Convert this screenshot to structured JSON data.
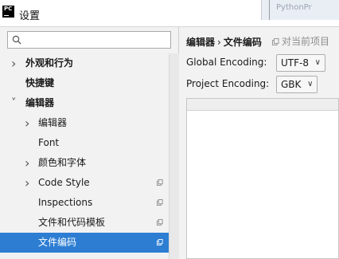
{
  "window": {
    "title": "设置",
    "app_icon_text": "PC",
    "background_text": "PythonPr"
  },
  "search": {
    "value": "",
    "placeholder": ""
  },
  "tree": {
    "items": [
      {
        "label": "外观和行为",
        "level": 0,
        "expander": "right",
        "bold": true
      },
      {
        "label": "快捷键",
        "level": 0,
        "expander": "none",
        "bold": true
      },
      {
        "label": "编辑器",
        "level": 0,
        "expander": "down",
        "bold": true
      },
      {
        "label": "编辑器",
        "level": 1,
        "expander": "right"
      },
      {
        "label": "Font",
        "level": 1,
        "expander": "none"
      },
      {
        "label": "颜色和字体",
        "level": 1,
        "expander": "right"
      },
      {
        "label": "Code Style",
        "level": 1,
        "expander": "right",
        "project_icon": true
      },
      {
        "label": "Inspections",
        "level": 1,
        "expander": "none",
        "project_icon": true
      },
      {
        "label": "文件和代码模板",
        "level": 1,
        "expander": "none",
        "project_icon": true
      },
      {
        "label": "文件编码",
        "level": 1,
        "expander": "none",
        "project_icon": true,
        "selected": true
      }
    ]
  },
  "breadcrumb": {
    "parent": "编辑器",
    "separator": "›",
    "current": "文件编码"
  },
  "project_note": "对当前项目",
  "encoding": {
    "global_label": "Global Encoding:",
    "global_value": "UTF-8",
    "project_label": "Project Encoding:",
    "project_value": "GBK"
  },
  "colors": {
    "selection": "#2d7ed3",
    "background": "#f2f2f2"
  }
}
